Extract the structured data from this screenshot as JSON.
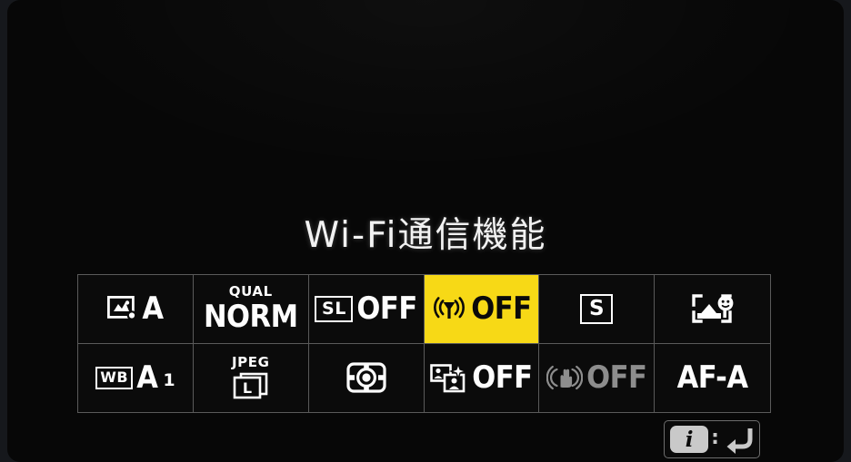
{
  "screen": {
    "title": "Wi-Fi通信機能",
    "background_color": "#070707",
    "frame_color": "#16181c",
    "highlight_color": "#f7d916",
    "text_color": "#fdfdfd",
    "dim_text_color": "#8d8d8d",
    "grid_line_color": "#5a5a5a"
  },
  "info_grid": {
    "rows": 2,
    "columns": 6,
    "cells": [
      {
        "id": "picture-control",
        "icon": "picture-control-icon",
        "value": "A",
        "label": "",
        "selected": false,
        "dimmed": false
      },
      {
        "id": "image-quality",
        "icon": "",
        "value": "NORM",
        "label": "QUAL",
        "selected": false,
        "dimmed": false
      },
      {
        "id": "flash-sync-mode",
        "icon": "slow-sync-icon",
        "value": "OFF",
        "label": "SL",
        "selected": false,
        "dimmed": false
      },
      {
        "id": "wifi-connection",
        "icon": "wifi-antenna-icon",
        "value": "OFF",
        "label": "",
        "selected": true,
        "dimmed": false
      },
      {
        "id": "release-mode",
        "icon": "single-frame-icon",
        "value": "",
        "label": "S",
        "selected": false,
        "dimmed": false
      },
      {
        "id": "af-area-mode",
        "icon": "face-priority-af-icon",
        "value": "",
        "label": "",
        "selected": false,
        "dimmed": false
      },
      {
        "id": "white-balance",
        "icon": "white-balance-icon",
        "value": "A",
        "label": "WB",
        "sub_value": "1",
        "selected": false,
        "dimmed": false
      },
      {
        "id": "image-size",
        "icon": "image-size-icon",
        "value": "L",
        "label": "JPEG",
        "selected": false,
        "dimmed": false
      },
      {
        "id": "metering-mode",
        "icon": "matrix-metering-icon",
        "value": "",
        "label": "",
        "selected": false,
        "dimmed": false
      },
      {
        "id": "portrait-retouch",
        "icon": "portrait-retouch-icon",
        "value": "OFF",
        "label": "",
        "selected": false,
        "dimmed": false
      },
      {
        "id": "vibration-reduction",
        "icon": "vibration-reduction-icon",
        "value": "OFF",
        "label": "",
        "selected": false,
        "dimmed": true
      },
      {
        "id": "focus-mode",
        "icon": "",
        "value": "AF-A",
        "label": "",
        "selected": false,
        "dimmed": false
      }
    ]
  },
  "hint_button": {
    "badge_label": "i",
    "separator": ":",
    "action_icon": "return-arrow-icon"
  }
}
